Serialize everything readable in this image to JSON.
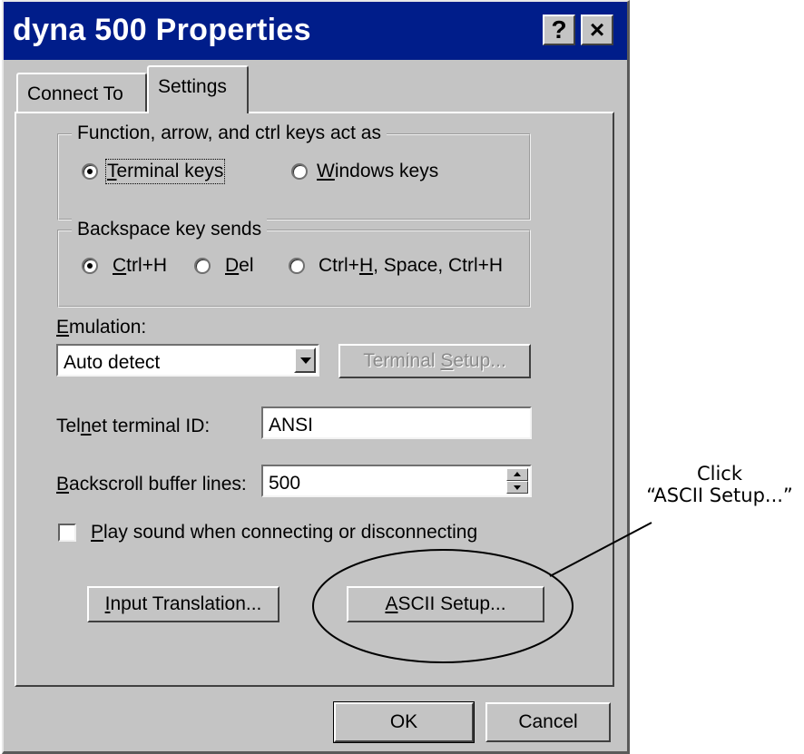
{
  "window": {
    "title": "dyna 500 Properties",
    "help_label": "?",
    "close_label": "×"
  },
  "tabs": [
    {
      "label": "Connect To",
      "active": false
    },
    {
      "label": "Settings",
      "active": true
    }
  ],
  "keys_group": {
    "legend": "Function, arrow, and ctrl keys act as",
    "options": [
      {
        "pre": "",
        "key": "T",
        "post": "erminal keys",
        "selected": true
      },
      {
        "pre": "",
        "key": "W",
        "post": "indows keys",
        "selected": false
      }
    ]
  },
  "backspace_group": {
    "legend": "Backspace key sends",
    "options": [
      {
        "pre": "",
        "key": "C",
        "post": "trl+H",
        "selected": true
      },
      {
        "pre": "",
        "key": "D",
        "post": "el",
        "selected": false
      },
      {
        "pre": "Ctrl+",
        "key": "H",
        "post": ", Space, Ctrl+H",
        "selected": false
      }
    ]
  },
  "emulation": {
    "label_key": "E",
    "label_rest": "mulation:",
    "value": "Auto detect",
    "setup_pre": "Terminal ",
    "setup_key": "S",
    "setup_post": "etup..."
  },
  "telnet": {
    "label_pre": "Tel",
    "label_key": "n",
    "label_post": "et terminal ID:",
    "value": "ANSI"
  },
  "backscroll": {
    "label_key": "B",
    "label_rest": "ackscroll buffer lines:",
    "value": "500"
  },
  "play_sound": {
    "label_key": "P",
    "label_rest": "lay sound when connecting or disconnecting",
    "checked": false
  },
  "input_translation": {
    "key": "I",
    "rest": "nput Translation..."
  },
  "ascii_setup": {
    "key": "A",
    "rest": "SCII Setup..."
  },
  "ok_label": "OK",
  "cancel_label": "Cancel",
  "annotation": {
    "line1": "Click",
    "line2": "“ASCII Setup...”"
  }
}
